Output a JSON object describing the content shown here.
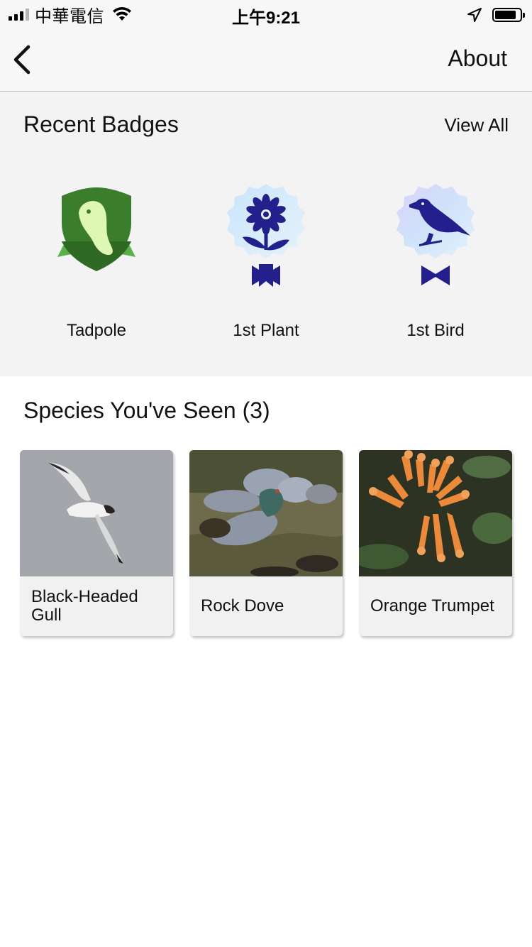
{
  "status_bar": {
    "carrier": "中華電信",
    "time": "上午9:21",
    "battery_level": 0.85
  },
  "nav": {
    "about_label": "About"
  },
  "badges": {
    "title": "Recent Badges",
    "view_all_label": "View All",
    "items": [
      {
        "label": "Tadpole",
        "icon": "tadpole-shield-icon"
      },
      {
        "label": "1st Plant",
        "icon": "flower-ribbon-icon"
      },
      {
        "label": "1st Bird",
        "icon": "bird-ribbon-icon"
      }
    ]
  },
  "species": {
    "title": "Species You've Seen (3)",
    "items": [
      {
        "name": "Black-Headed Gull"
      },
      {
        "name": "Rock Dove"
      },
      {
        "name": "Orange Trumpet"
      }
    ]
  },
  "colors": {
    "badge_green": "#3a7d2c",
    "badge_tadpole": "#dff7b5",
    "badge_blue": "#231f8c",
    "badge_bg_light": "#d8ecf8"
  }
}
